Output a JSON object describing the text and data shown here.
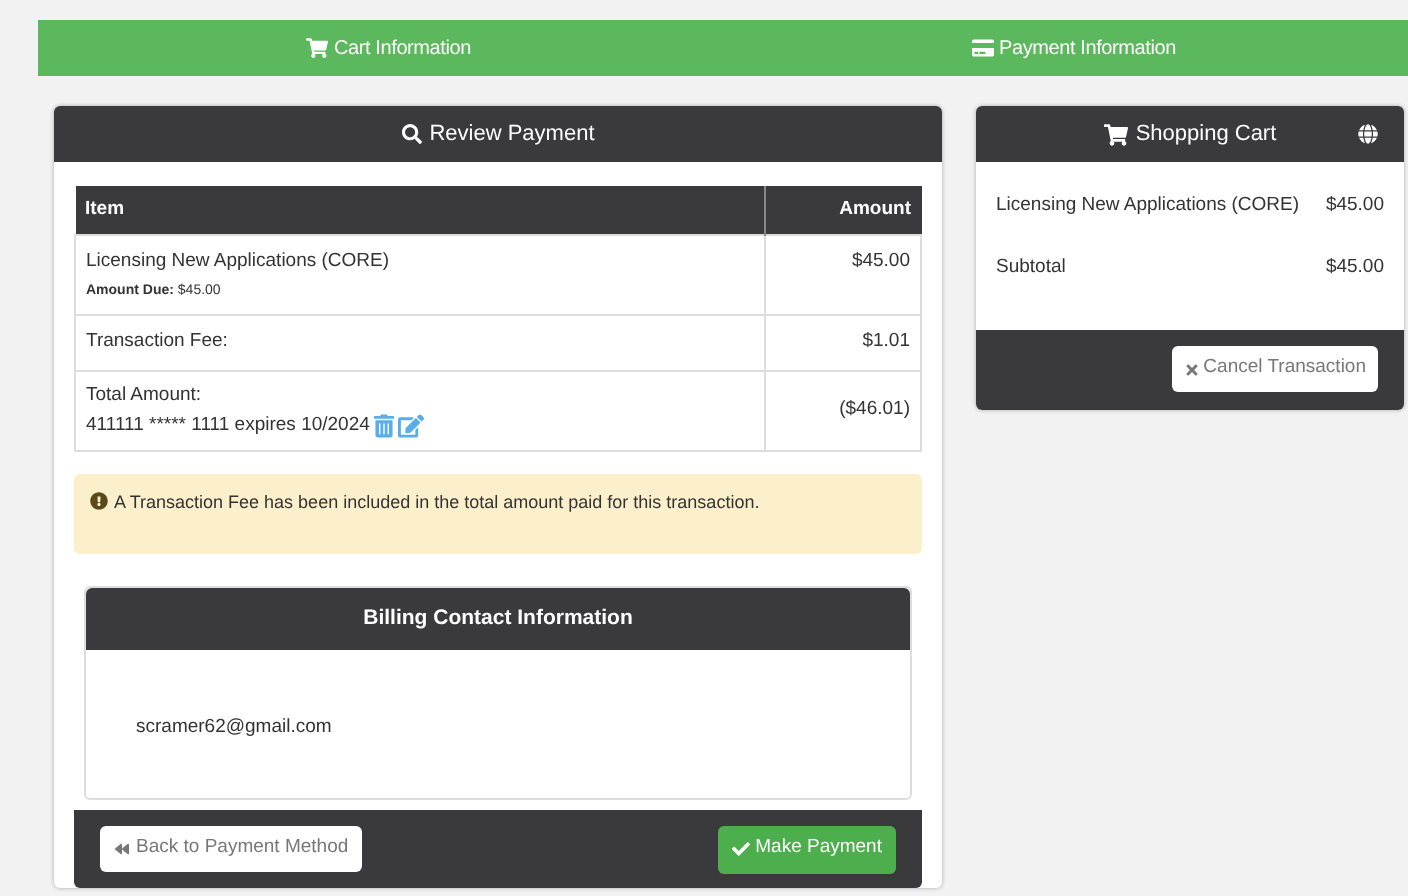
{
  "steps": [
    "Cart Information",
    "Payment Information"
  ],
  "review": {
    "title": "Review Payment",
    "columns": [
      "Item",
      "Amount"
    ],
    "rows": [
      {
        "kind": "item",
        "label": "Licensing New Applications (CORE)",
        "sub_label": "Amount Due:",
        "sub_value": "$45.00",
        "amount": "$45.00"
      },
      {
        "kind": "fee",
        "label": "Transaction Fee:",
        "amount": "$1.01"
      },
      {
        "kind": "total",
        "label": "Total Amount:",
        "card": "411111 ***** 1111 expires 10/2024",
        "amount": "($46.01)"
      }
    ],
    "notice": "A Transaction Fee has been included in the total amount paid for this transaction.",
    "billing": {
      "title": "Billing Contact Information",
      "email": "scramer62@gmail.com"
    },
    "back_button": "Back to Payment Method",
    "pay_button": "Make Payment"
  },
  "cart": {
    "title": "Shopping Cart",
    "lines": [
      {
        "label": "Licensing New Applications (CORE)",
        "amount": "$45.00"
      },
      {
        "label": "Subtotal",
        "amount": "$45.00"
      }
    ],
    "cancel_button": "Cancel Transaction"
  }
}
